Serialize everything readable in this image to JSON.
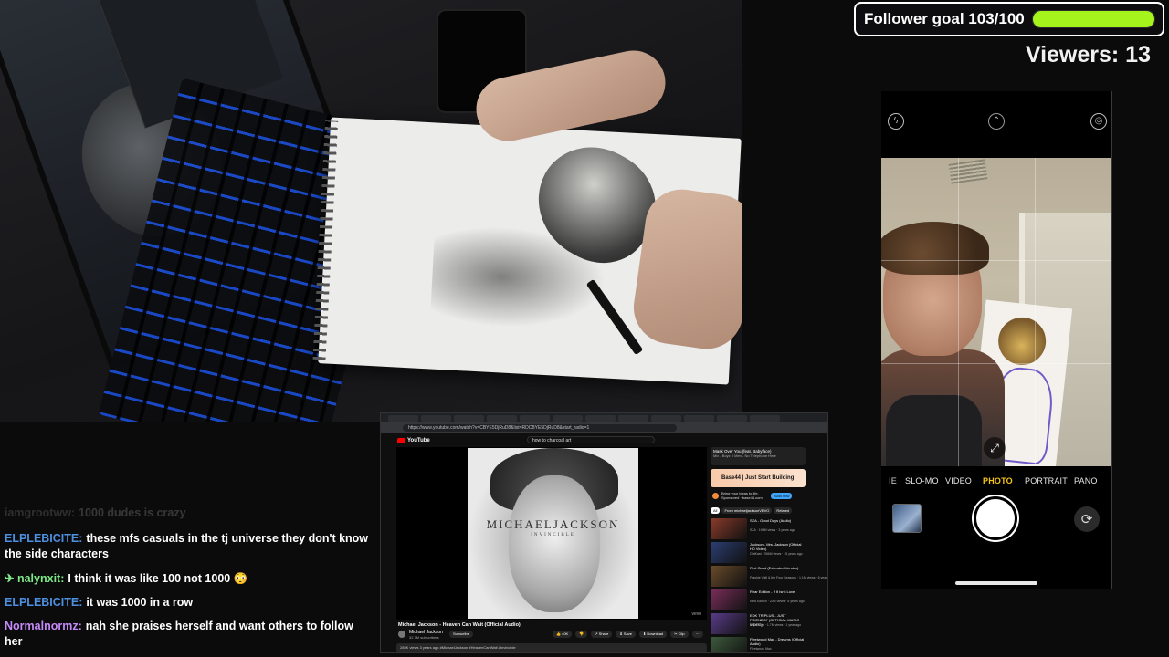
{
  "overlay": {
    "follower_goal": {
      "label": "Follower goal 103/100",
      "current": 103,
      "target": 100,
      "progress": 1.0,
      "fill_color": "#a5f51c"
    },
    "viewers": "Viewers: 13"
  },
  "camera_app": {
    "modes": [
      "IE",
      "SLO-MO",
      "VIDEO",
      "PHOTO",
      "PORTRAIT",
      "PANO"
    ],
    "active_mode": "PHOTO",
    "active_color": "#f5c518",
    "icons": [
      "flash-off-icon",
      "chevron-up-icon",
      "live-photo-icon",
      "expand-icon",
      "gallery-thumbnail",
      "shutter-button",
      "flip-camera-icon"
    ]
  },
  "chat": {
    "messages": [
      {
        "user": "iamgrootww:",
        "text": "1000 dudes is crazy",
        "color": "#cfcfcf",
        "faded": true
      },
      {
        "user": "ELPLEBICITE:",
        "text": "these mfs casuals in the tj universe they don't know the side characters",
        "color": "#4d8fe0"
      },
      {
        "user": "nalynxit:",
        "text": "I think it was like 100 not 1000 😳",
        "color": "#7ee787",
        "badge": "✈"
      },
      {
        "user": "ELPLEBICITE:",
        "text": "it was 1000 in a row",
        "color": "#4d8fe0"
      },
      {
        "user": "Normalnormz:",
        "text": "nah she praises herself and want others to follow her",
        "color": "#c58af9"
      }
    ]
  },
  "browser": {
    "url": "https://www.youtube.com/watch?v=CBYE5DjRuD8&list=RDCBYE5DjRuD8&start_radio=1",
    "site_name": "YouTube",
    "search_query": "how to charcoal art",
    "video": {
      "album_title": "MICHAELJACKSON",
      "album_subtitle": "INVINCIBLE",
      "watermark": "vevo",
      "title": "Michael Jackson - Heaven Can Wait (Official Audio)",
      "channel": "Michael Jackson",
      "subscribers": "32.7M subscribers",
      "subscribe_label": "Subscribe",
      "actions": [
        "👍 40K",
        "👎",
        "↗ Share",
        "⬇ Save",
        "⬇ Download",
        "✂ Clip",
        "⋯"
      ],
      "description": "285K views  3 years ago  #MichaelJackson #HeavenCanWait #Invincible"
    },
    "sidebar": {
      "now_playing": "Mask Over You (feat. Babyface)",
      "now_playing_sub": "Mix - Boyz II Men - No Telephone Here",
      "ad_text": "Base44 | Just Start Building",
      "promo_text": "Bring your ideas to life. Sponsored · base44.com",
      "promo_button": "Build now",
      "chips": [
        "All",
        "From michaeljacksonVEVO",
        "Related",
        "For you"
      ],
      "videos": [
        {
          "title": "SZA - Good Days (Audio)",
          "channel": "SZA",
          "meta": "196M views · 3 years ago",
          "color": "#8a3b2a"
        },
        {
          "title": "Jackson - Mrs. Jackson (Official HD Video)",
          "channel": "OutKast",
          "meta": "394M views · 15 years ago",
          "color": "#2c3e73"
        },
        {
          "title": "Red Good (Extended Version)",
          "channel": "Frankie Valli & the Four Seasons",
          "meta": "1.1M views · 6 years ago",
          "color": "#6b4b2a"
        },
        {
          "title": "Rear Edition - If It Isn't Love",
          "channel": "New Edition",
          "meta": "20M views · 6 years ago",
          "color": "#7a2e5a"
        },
        {
          "title": "EDK TRIPLUS - JUST FRIENDS? (OFFICIAL MUSIC VIDEO)",
          "channel": "Bryn Trips",
          "meta": "1.7M views · 1 year ago",
          "color": "#5a3c8a"
        },
        {
          "title": "Fleetwood Mac - Dreams (Official Audio)",
          "channel": "Fleetwood Mac",
          "meta": "",
          "color": "#3d5a3d"
        }
      ]
    }
  }
}
